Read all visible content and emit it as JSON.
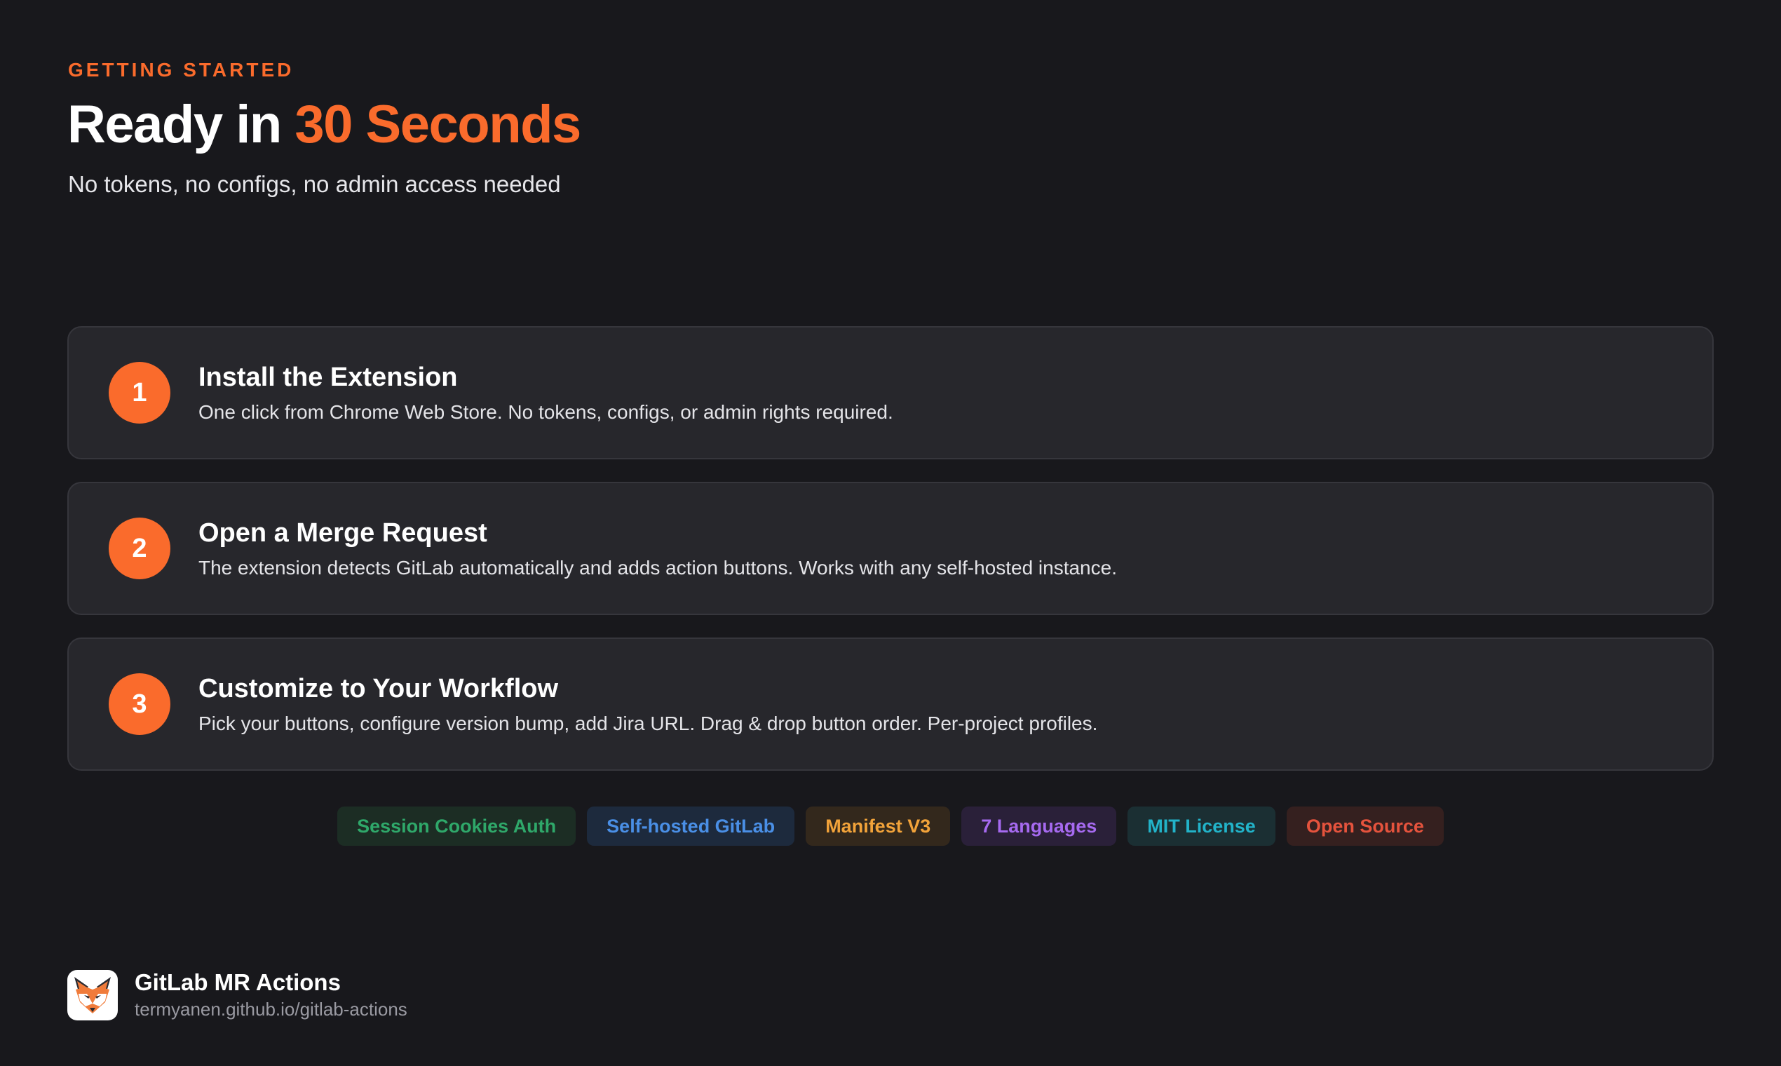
{
  "hero": {
    "eyebrow": "GETTING STARTED",
    "title_main": "Ready in ",
    "title_accent": "30 Seconds",
    "subtitle": "No tokens, no configs, no admin access needed"
  },
  "steps": [
    {
      "number": "1",
      "title": "Install the Extension",
      "description": "One click from Chrome Web Store. No tokens, configs, or admin rights required."
    },
    {
      "number": "2",
      "title": "Open a Merge Request",
      "description": "The extension detects GitLab automatically and adds action buttons. Works with any self-hosted instance."
    },
    {
      "number": "3",
      "title": "Customize to Your Workflow",
      "description": "Pick your buttons, configure version bump, add Jira URL. Drag & drop button order. Per-project profiles."
    }
  ],
  "badges": [
    {
      "label": "Session Cookies Auth",
      "color": "#2fa86a",
      "bg": "#1c2d24"
    },
    {
      "label": "Self-hosted GitLab",
      "color": "#4a8fe6",
      "bg": "#1d2a3d"
    },
    {
      "label": "Manifest V3",
      "color": "#f2a33a",
      "bg": "#33281c"
    },
    {
      "label": "7 Languages",
      "color": "#a66af0",
      "bg": "#2a2039"
    },
    {
      "label": "MIT License",
      "color": "#22b3c9",
      "bg": "#1b2f33"
    },
    {
      "label": "Open Source",
      "color": "#e5533d",
      "bg": "#35201f"
    }
  ],
  "footer": {
    "name": "GitLab MR Actions",
    "url": "termyanen.github.io/gitlab-actions",
    "logo_icon": "fox-logo-icon"
  },
  "colors": {
    "accent": "#fa6b2c",
    "background": "#18181c",
    "card": "#27272c"
  }
}
